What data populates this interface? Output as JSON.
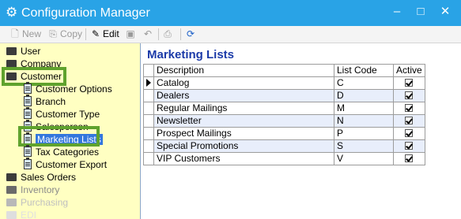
{
  "window": {
    "title": "Configuration Manager",
    "controls": {
      "minimize": "–",
      "maximize": "□",
      "close": "✕"
    }
  },
  "toolbar": {
    "new_label": "New",
    "copy_label": "Copy",
    "edit_label": "Edit"
  },
  "sidebar": {
    "items": [
      {
        "label": "User",
        "level": 0,
        "icon": "folder-icon"
      },
      {
        "label": "Company",
        "level": 0,
        "icon": "folder-icon"
      },
      {
        "label": "Customer",
        "level": 0,
        "icon": "folder-open-icon",
        "highlighted": true
      },
      {
        "label": "Customer Options",
        "level": 1,
        "icon": "clipboard-icon"
      },
      {
        "label": "Branch",
        "level": 1,
        "icon": "clipboard-icon"
      },
      {
        "label": "Customer Type",
        "level": 1,
        "icon": "clipboard-icon"
      },
      {
        "label": "Salesperson",
        "level": 1,
        "icon": "clipboard-icon"
      },
      {
        "label": "Marketing Lists",
        "level": 1,
        "icon": "clipboard-icon",
        "selected": true,
        "highlighted": true
      },
      {
        "label": "Tax Categories",
        "level": 1,
        "icon": "clipboard-icon"
      },
      {
        "label": "Customer Export",
        "level": 1,
        "icon": "clipboard-icon"
      },
      {
        "label": "Sales Orders",
        "level": 0,
        "icon": "folder-icon"
      },
      {
        "label": "Inventory",
        "level": 0,
        "icon": "folder-icon",
        "disabled": true
      },
      {
        "label": "Purchasing",
        "level": 0,
        "icon": "folder-icon",
        "disabled": true
      },
      {
        "label": "EDI",
        "level": 0,
        "icon": "folder-icon",
        "disabled": true
      }
    ]
  },
  "main": {
    "heading": "Marketing Lists",
    "columns": {
      "description": "Description",
      "list_code": "List Code",
      "active": "Active"
    },
    "rows": [
      {
        "description": "Catalog",
        "list_code": "C",
        "active": true,
        "current": true
      },
      {
        "description": "Dealers",
        "list_code": "D",
        "active": true
      },
      {
        "description": "Regular Mailings",
        "list_code": "M",
        "active": true
      },
      {
        "description": "Newsletter",
        "list_code": "N",
        "active": true
      },
      {
        "description": "Prospect Mailings",
        "list_code": "P",
        "active": true
      },
      {
        "description": "Special Promotions",
        "list_code": "S",
        "active": true
      },
      {
        "description": "VIP Customers",
        "list_code": "V",
        "active": true
      }
    ]
  },
  "colors": {
    "titlebar": "#29a3e6",
    "sidebar_bg": "#ffffc2",
    "heading": "#1b3aa8",
    "highlight_border": "#5fa22d",
    "alt_row": "#e8eefb",
    "selection": "#3377dd"
  }
}
